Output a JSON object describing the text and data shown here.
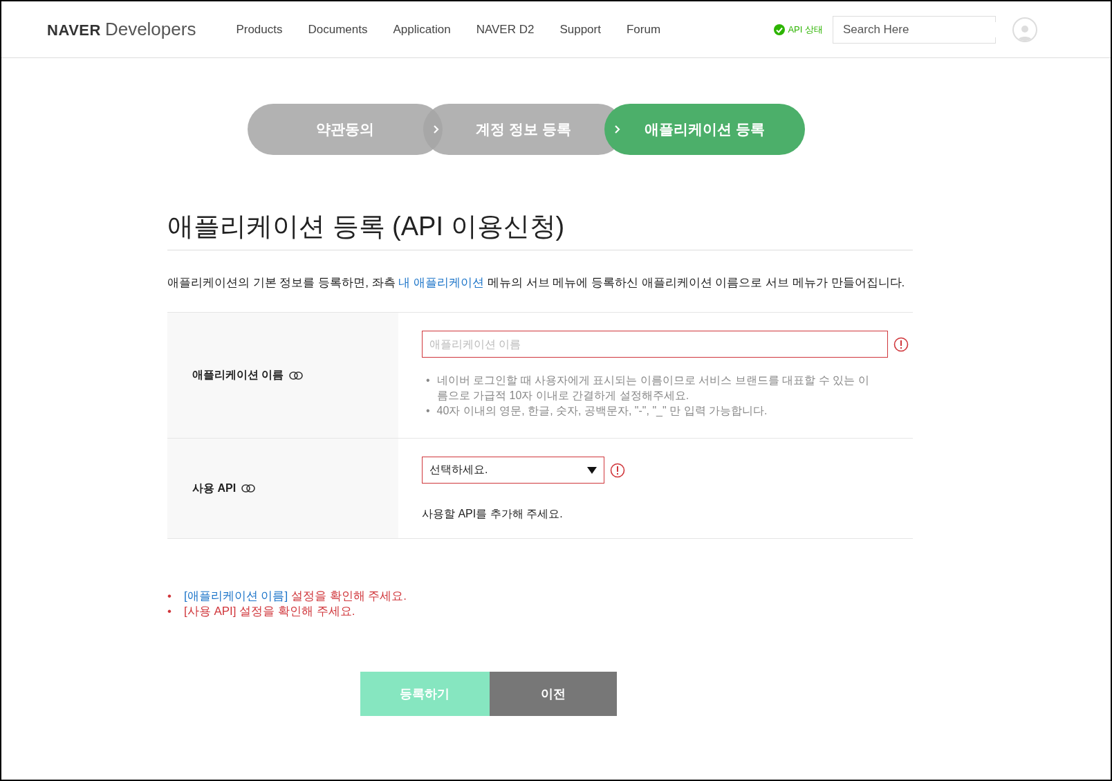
{
  "header": {
    "logo_brand": "NAVER",
    "logo_product": "Developers",
    "nav": [
      "Products",
      "Documents",
      "Application",
      "NAVER D2",
      "Support",
      "Forum"
    ],
    "api_status": "API 상태",
    "search": {
      "placeholder": "Search Here"
    }
  },
  "steps": [
    {
      "label": "약관동의",
      "selected": false
    },
    {
      "label": "계정 정보 등록",
      "selected": false
    },
    {
      "label": "애플리케이션 등록",
      "selected": true
    }
  ],
  "title": "애플리케이션 등록 (API 이용신청)",
  "description": {
    "before": "애플리케이션의 기본 정보를 등록하면, 좌측 ",
    "link": "내 애플리케이션",
    "after": " 메뉴의 서브 메뉴에 등록하신 애플리케이션 이름으로 서브 메뉴가 만들어집니다."
  },
  "bullet": "•",
  "form": [
    {
      "kind": "text",
      "label": "애플리케이션 이름",
      "placeholder": "애플리케이션 이름",
      "error": true,
      "hints": [
        "네이버 로그인할 때 사용자에게 표시되는 이름이므로 서비스 브랜드를 대표할 수 있는 이름으로 가급적 10자 이내로 간결하게 설정해주세요.",
        "40자 이내의 영문, 한글, 숫자, 공백문자, \"-\", \"_\" 만 입력 가능합니다."
      ]
    },
    {
      "kind": "select",
      "label": "사용 API",
      "value": "선택하세요.",
      "error": true,
      "note": "사용할 API를 추가해 주세요."
    }
  ],
  "errors": [
    {
      "field": "[애플리케이션 이름]",
      "field_linked": true,
      "message": " 설정을 확인해 주세요."
    },
    {
      "field": "[사용 API]",
      "field_linked": false,
      "message": " 설정을 확인해 주세요."
    }
  ],
  "buttons": [
    {
      "label": "등록하기",
      "kind": "primary",
      "disabled": true
    },
    {
      "label": "이전",
      "kind": "secondary",
      "disabled": false
    }
  ]
}
